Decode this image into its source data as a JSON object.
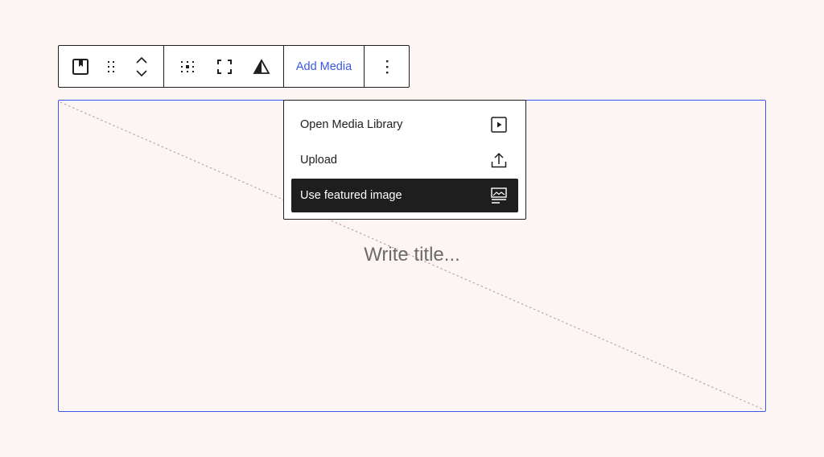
{
  "toolbar": {
    "block_type_icon": "cover-block-icon",
    "drag_handle_icon": "drag-handle-icon",
    "move_up_icon": "chevron-up-icon",
    "move_down_icon": "chevron-down-icon",
    "focal_point_icon": "position-grid-icon",
    "full_height_icon": "fullscreen-icon",
    "overlay_icon": "contrast-icon",
    "add_media_label": "Add Media",
    "more_options_icon": "more-vertical-icon"
  },
  "dropdown": {
    "items": [
      {
        "label": "Open Media Library",
        "icon": "media-library-icon",
        "active": false
      },
      {
        "label": "Upload",
        "icon": "upload-icon",
        "active": false
      },
      {
        "label": "Use featured image",
        "icon": "featured-image-icon",
        "active": true
      }
    ]
  },
  "cover": {
    "title_placeholder": "Write title..."
  },
  "colors": {
    "accent": "#3858e9",
    "background": "#fdf5f3",
    "dark": "#1e1e1e",
    "placeholder_text": "#6b6b6b"
  }
}
